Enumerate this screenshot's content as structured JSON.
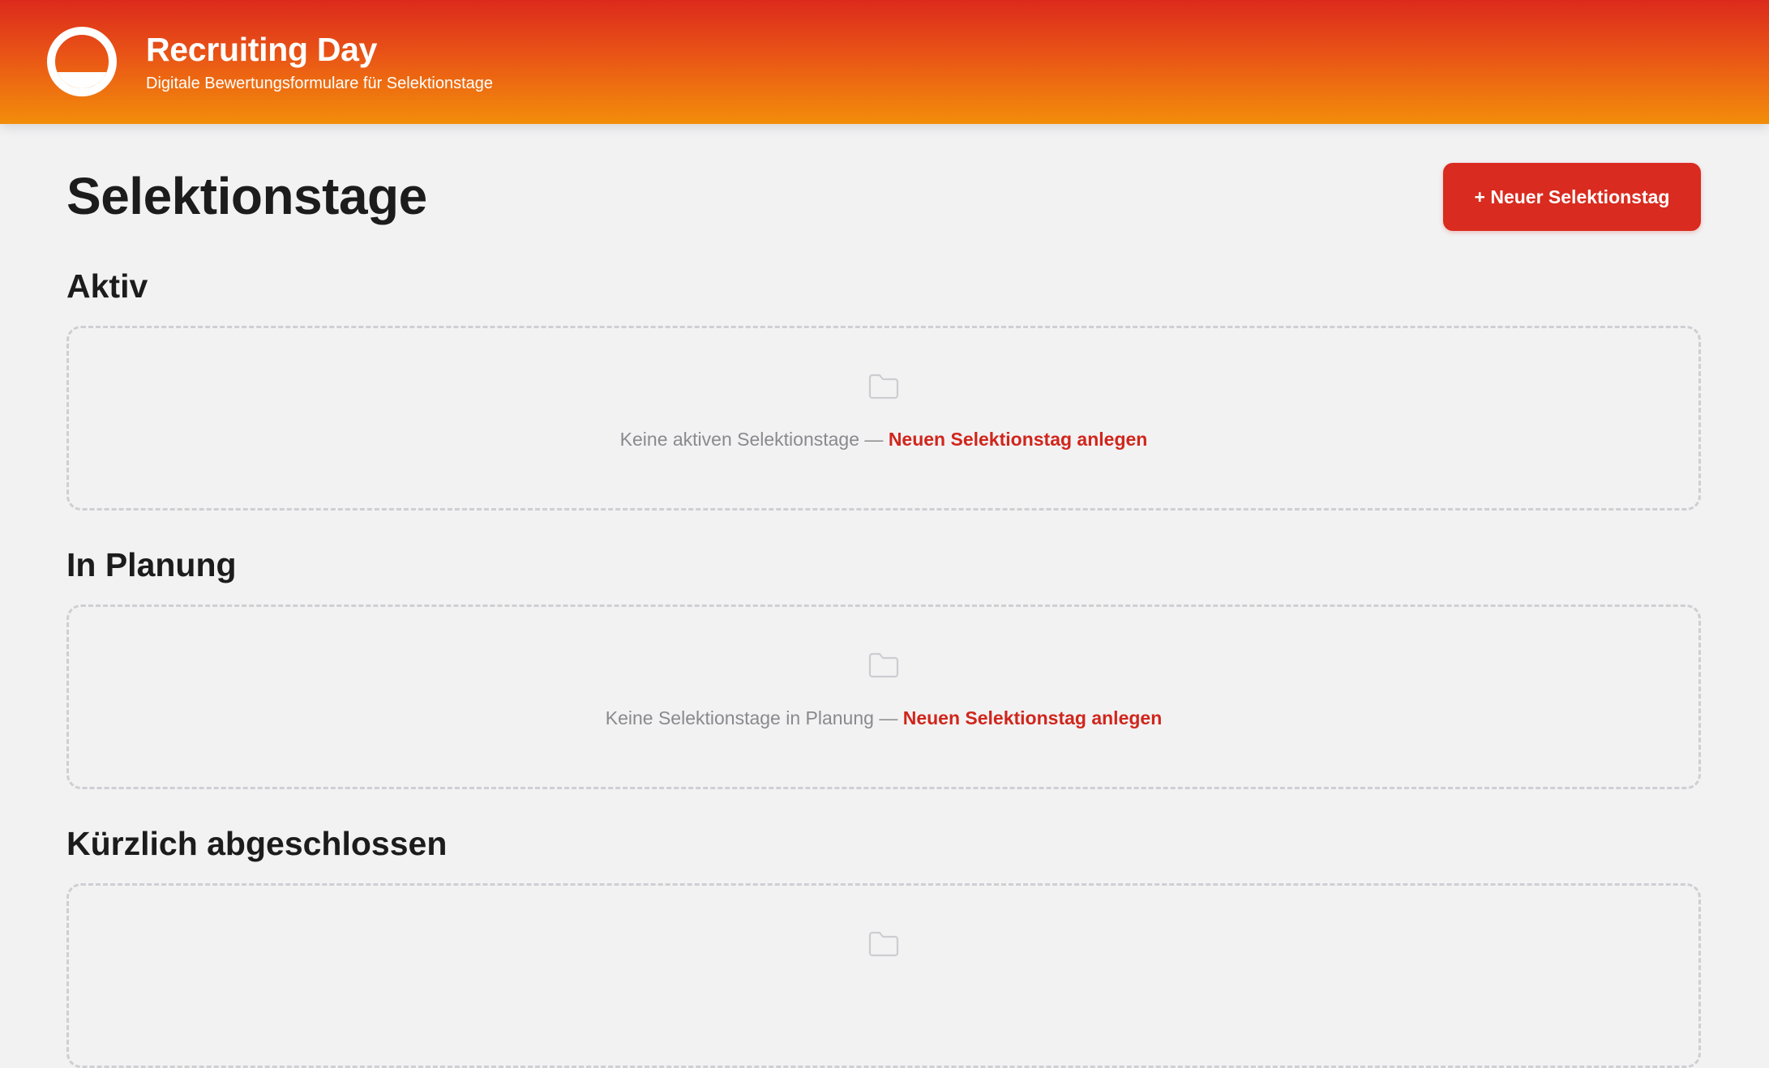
{
  "header": {
    "app_title": "Recruiting Day",
    "app_subtitle": "Digitale Bewertungsformulare für Selektionstage",
    "logo_icon": "half-circle-logo-icon"
  },
  "main": {
    "page_title": "Selektionstage",
    "new_button_label": "+ Neuer Selektionstag",
    "sections": [
      {
        "heading": "Aktiv",
        "empty_text": "Keine aktiven Selektionstage —",
        "link_label": "Neuen Selektionstag anlegen",
        "icon": "folder-icon"
      },
      {
        "heading": "In Planung",
        "empty_text": "Keine Selektionstage in Planung —",
        "link_label": "Neuen Selektionstag anlegen",
        "icon": "folder-icon"
      },
      {
        "heading": "Kürzlich abgeschlossen",
        "empty_text": "",
        "link_label": "",
        "icon": "folder-icon"
      }
    ]
  },
  "colors": {
    "header_gradient_top": "#dc2a1c",
    "header_gradient_bottom": "#f38d0a",
    "accent": "#d92b1f",
    "background": "#f2f2f3"
  }
}
